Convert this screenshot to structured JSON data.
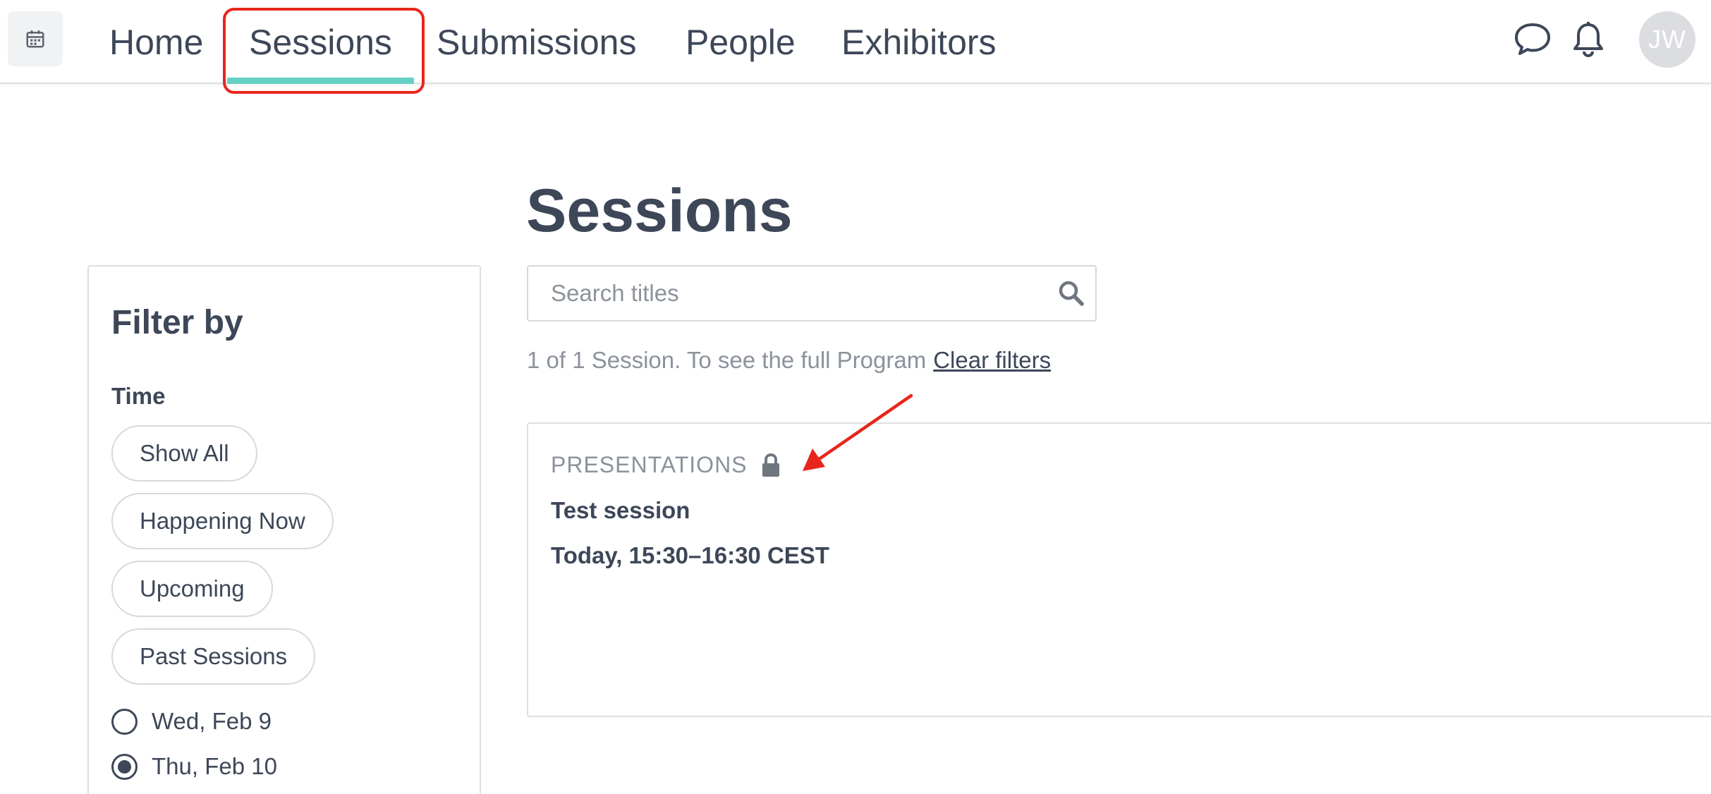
{
  "nav": {
    "tabs": [
      {
        "label": "Home"
      },
      {
        "label": "Sessions",
        "active": true
      },
      {
        "label": "Submissions"
      },
      {
        "label": "People"
      },
      {
        "label": "Exhibitors"
      }
    ],
    "avatar_initials": "JW",
    "icons": [
      "calendar-icon",
      "chat-icon",
      "bell-icon"
    ],
    "accent_color": "#66d0c6"
  },
  "page": {
    "title": "Sessions"
  },
  "filter": {
    "title": "Filter by",
    "time_label": "Time",
    "time_options": [
      "Show All",
      "Happening Now",
      "Upcoming",
      "Past Sessions"
    ],
    "dates": [
      {
        "label": "Wed, Feb 9",
        "selected": false
      },
      {
        "label": "Thu, Feb 10",
        "selected": true
      }
    ]
  },
  "search": {
    "placeholder": "Search titles",
    "value": ""
  },
  "results": {
    "summary": "1 of 1 Session. To see the full Program",
    "clear_link": "Clear filters"
  },
  "sessions": [
    {
      "type": "PRESENTATIONS",
      "locked": true,
      "title": "Test session",
      "time": "Today, 15:30–16:30 CEST"
    }
  ],
  "annotations": {
    "highlight_color": "#e8251c"
  }
}
